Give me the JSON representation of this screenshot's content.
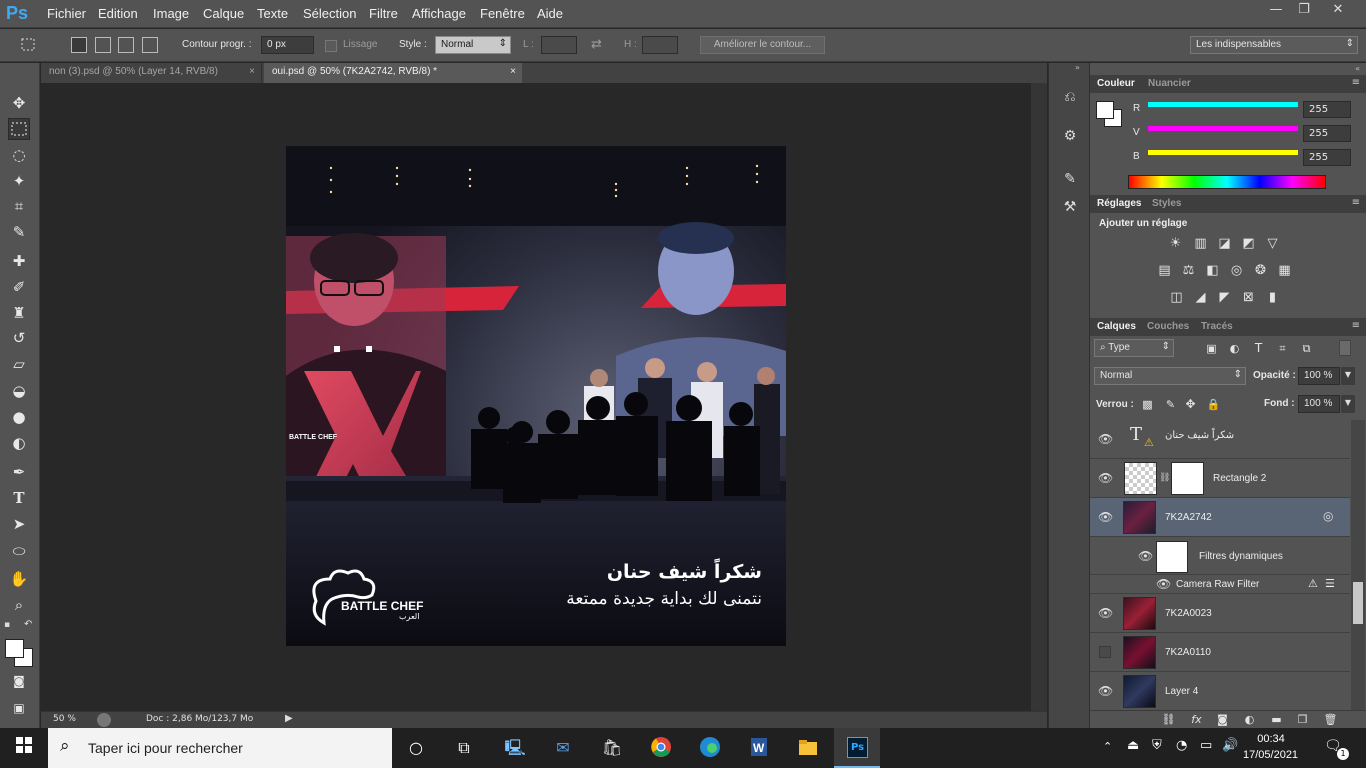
{
  "app": {
    "logo": "Ps"
  },
  "menu": [
    "Fichier",
    "Edition",
    "Image",
    "Calque",
    "Texte",
    "Sélection",
    "Filtre",
    "Affichage",
    "Fenêtre",
    "Aide"
  ],
  "window_controls": {
    "minimize": "—",
    "restore": "❐",
    "close": "✕"
  },
  "options": {
    "feather_label": "Contour progr. :",
    "feather_value": "0 px",
    "antialias_label": "Lissage",
    "style_label": "Style :",
    "style_value": "Normal",
    "width_label": "L :",
    "height_label": "H :",
    "refine_button": "Améliorer le contour...",
    "workspace": "Les indispensables"
  },
  "tabs": [
    {
      "label": "non (3).psd @ 50% (Layer 14, RVB/8)",
      "close": "×"
    },
    {
      "label": "oui.psd @ 50% (7K2A2742, RVB/8) *",
      "close": "×"
    }
  ],
  "status": {
    "zoom": "50 %",
    "doc": "Doc : 2,86 Mo/123,7 Mo"
  },
  "artwork": {
    "headline": "شكراً شيف حنان",
    "subline": "نتمنى لك بداية جديدة ممتعة",
    "logo_text": "BATTLE CHEF",
    "logo_sub": "العرب",
    "jacket_logo": "BATTLE CHEF",
    "x_mark": "X"
  },
  "color_panel": {
    "tabs": [
      "Couleur",
      "Nuancier"
    ],
    "channels": [
      {
        "label": "R",
        "value": "255",
        "color": "#00ffff"
      },
      {
        "label": "V",
        "value": "255",
        "color": "#ff00ff"
      },
      {
        "label": "B",
        "value": "255",
        "color": "#ffff00"
      }
    ]
  },
  "adjustments_panel": {
    "tabs": [
      "Réglages",
      "Styles"
    ],
    "title": "Ajouter un réglage"
  },
  "layers_panel": {
    "tabs": [
      "Calques",
      "Couches",
      "Tracés"
    ],
    "filter_type": "Type",
    "blend_mode": "Normal",
    "opacity_label": "Opacité :",
    "opacity_value": "100 %",
    "lock_label": "Verrou :",
    "fill_label": "Fond :",
    "fill_value": "100 %",
    "layers": [
      {
        "name": "شكراً شيف حنان",
        "kind": "text"
      },
      {
        "name": "Rectangle 2",
        "kind": "shape"
      },
      {
        "name": "7K2A2742",
        "kind": "smart",
        "selected": true
      },
      {
        "name": "Filtres dynamiques",
        "kind": "filter-mask"
      },
      {
        "name": "Camera Raw Filter",
        "kind": "filter"
      },
      {
        "name": "7K2A0023",
        "kind": "image"
      },
      {
        "name": "7K2A0110",
        "kind": "image-hidden"
      },
      {
        "name": "Layer 4",
        "kind": "image"
      }
    ]
  },
  "taskbar": {
    "search_placeholder": "Taper ici pour rechercher",
    "time": "00:34",
    "date": "17/05/2021",
    "notification_count": "1"
  }
}
